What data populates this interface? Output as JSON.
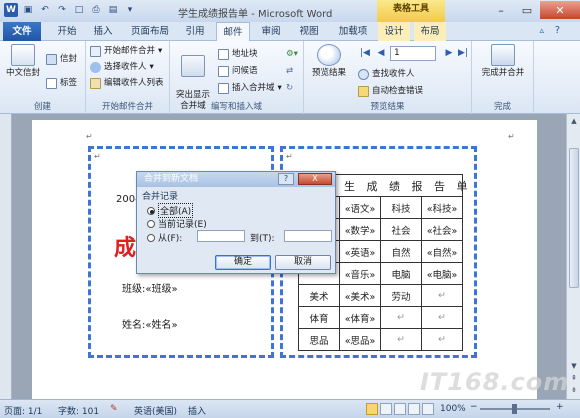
{
  "title_bar": {
    "title": "学生成绩报告单 - Microsoft Word",
    "context_tab": "表格工具",
    "quick_access_icons": [
      "word-icon",
      "save-icon",
      "undo-icon",
      "redo-icon",
      "new-doc-icon",
      "print-preview-icon",
      "open-icon",
      "customize-icon"
    ]
  },
  "tabs": [
    {
      "label": "文件"
    },
    {
      "label": "开始"
    },
    {
      "label": "插入"
    },
    {
      "label": "页面布局"
    },
    {
      "label": "引用"
    },
    {
      "label": "邮件"
    },
    {
      "label": "审阅"
    },
    {
      "label": "视图"
    },
    {
      "label": "加载项"
    },
    {
      "label": "设计"
    },
    {
      "label": "布局"
    }
  ],
  "active_tab": "邮件",
  "ribbon": {
    "create_group": {
      "label": "创建",
      "chinese_envelope": "中文信封",
      "envelope": "信封",
      "labels": "标签"
    },
    "start_merge_group": {
      "label": "开始邮件合并",
      "start": "开始邮件合并",
      "select_recipients": "选择收件人",
      "edit_recipients": "编辑收件人列表"
    },
    "write_insert_group": {
      "label": "编写和插入域",
      "highlight": "突出显示\n合并域",
      "address_block": "地址块",
      "greeting": "问候语",
      "insert_field": "插入合并域"
    },
    "preview_group": {
      "label": "预览结果",
      "preview": "预览结果",
      "record_number": "1",
      "find_recipient": "查找收件人",
      "auto_check": "自动检查错误"
    },
    "finish_group": {
      "label": "完成",
      "finish": "完成并合并"
    }
  },
  "document": {
    "left_year": "2004",
    "left_big": "成",
    "class_line": "班级:«班级»",
    "name_line": "姓名:«姓名»",
    "table_title": "生 成 绩 报 告 单",
    "table_rows": [
      [
        "«语文»",
        "科技",
        "«科技»"
      ],
      [
        "«数学»",
        "社会",
        "«社会»"
      ],
      [
        "«英语»",
        "自然",
        "«自然»"
      ],
      [
        "«音乐»",
        "电脑",
        "«电脑»"
      ],
      [
        "美术",
        "«美术»",
        "劳动",
        "↵"
      ],
      [
        "体育",
        "«体育»",
        "↵",
        "↵"
      ],
      [
        "思品",
        "«思品»",
        "↵",
        "↵"
      ]
    ]
  },
  "dialog": {
    "title": "合并到新文档",
    "help": "?",
    "close": "X",
    "group_label": "合并记录",
    "opt_all": "全部(A)",
    "opt_current": "当前记录(E)",
    "opt_from": "从(F):",
    "to_label": "到(T):",
    "from_value": "",
    "to_value": "",
    "ok": "确定",
    "cancel": "取消"
  },
  "status_bar": {
    "page": "页面: 1/1",
    "words": "字数: 101",
    "language": "英语(美国)",
    "mode": "插入",
    "zoom": "100%"
  },
  "watermark": "IT168.com"
}
